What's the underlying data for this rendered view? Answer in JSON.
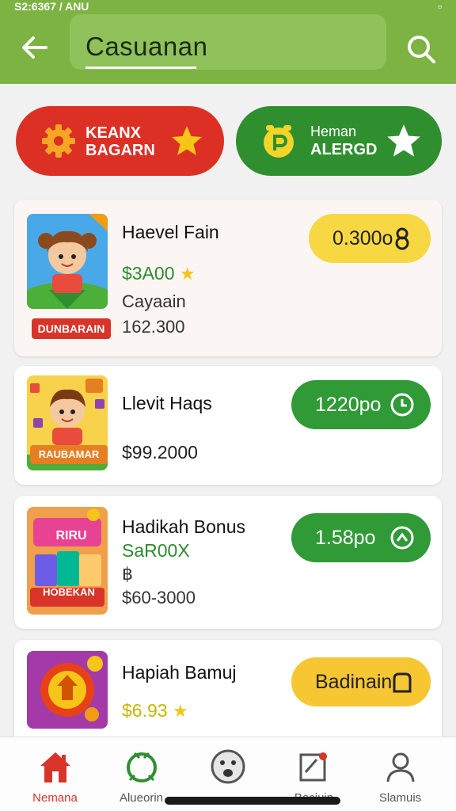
{
  "status": {
    "left": "S2:6367 / ANU",
    "right": "▫"
  },
  "header": {
    "search_text": "Casuanan",
    "back_icon": "arrow-left-icon",
    "search_icon": "search-icon"
  },
  "promos": [
    {
      "line1": "KEANX",
      "line2": "BAGARN",
      "color": "#dc3024",
      "left_icon": "gear-icon",
      "right_icon": "star-icon"
    },
    {
      "line1": "Heman",
      "line2": "ALERGD",
      "color": "#2f8f2f",
      "left_icon": "clock-badge-icon",
      "right_icon": "star-icon"
    }
  ],
  "cards": [
    {
      "title": "Haevel Fain",
      "price": "$3A00",
      "line3": "Cayaain",
      "line4": "162.300",
      "button": "0.300o",
      "thumb_banner": "DUNBARAIN"
    },
    {
      "title": "Llevit Haqs",
      "price": "$99.2000",
      "button": "1220po",
      "thumb_banner": "RAUBAMAR"
    },
    {
      "title": "Hadikah Bonus",
      "price": "SaR00X",
      "line3": "฿",
      "line4": "$60-3000",
      "button": "1.58po",
      "thumb_banner": "HOBEKAN",
      "thumb_top": "RIRU"
    },
    {
      "title": "Hapiah Bamuj",
      "price": "$6.93",
      "button": "Badinain"
    }
  ],
  "nav": [
    {
      "label": "Nemana",
      "icon": "home-icon",
      "active": true
    },
    {
      "label": "Alueorin",
      "icon": "circle-arrow-icon",
      "active": false
    },
    {
      "label": "",
      "icon": "smiley-icon",
      "active": false
    },
    {
      "label": "Beciuin",
      "icon": "document-icon",
      "active": false
    },
    {
      "label": "Slamuis",
      "icon": "profile-icon",
      "active": false
    }
  ],
  "colors": {
    "header": "#7cb342",
    "accent_red": "#dc3024",
    "accent_green": "#2f9a36",
    "price_green": "#2e8b2e",
    "price_yellow": "#c9b400",
    "star": "#f5c518"
  }
}
